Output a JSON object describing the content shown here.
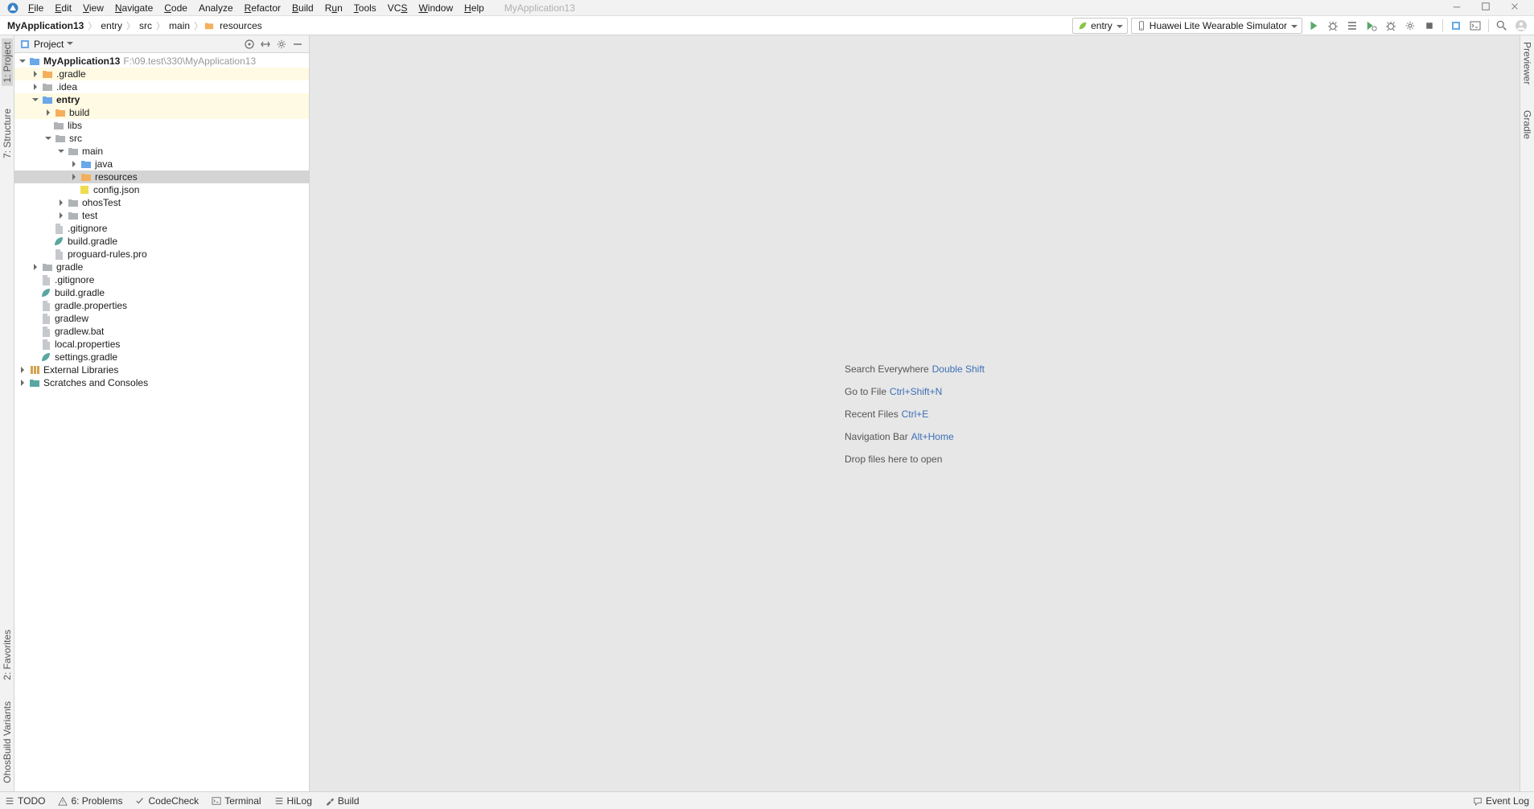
{
  "title": "MyApplication13",
  "menu": {
    "file": "File",
    "edit": "Edit",
    "view": "View",
    "navigate": "Navigate",
    "code": "Code",
    "analyze": "Analyze",
    "refactor": "Refactor",
    "build": "Build",
    "run": "Run",
    "tools": "Tools",
    "vcs": "VCS",
    "window": "Window",
    "help": "Help"
  },
  "breadcrumb": {
    "c0": "MyApplication13",
    "c1": "entry",
    "c2": "src",
    "c3": "main",
    "c4": "resources"
  },
  "run_config": "entry",
  "device": "Huawei Lite Wearable Simulator",
  "sidebar": {
    "title": "Project",
    "root": {
      "name": "MyApplication13",
      "path": "F:\\09.test\\330\\MyApplication13"
    },
    "gradle_dir": ".gradle",
    "idea_dir": ".idea",
    "entry": "entry",
    "build": "build",
    "libs": "libs",
    "src": "src",
    "main": "main",
    "java": "java",
    "resources": "resources",
    "config": "config.json",
    "ohosTest": "ohosTest",
    "test": "test",
    "gitignore": ".gitignore",
    "build_gradle": "build.gradle",
    "proguard": "proguard-rules.pro",
    "gradle_folder": "gradle",
    "root_gitignore": ".gitignore",
    "root_build_gradle": "build.gradle",
    "gradle_props": "gradle.properties",
    "gradlew": "gradlew",
    "gradlew_bat": "gradlew.bat",
    "local_props": "local.properties",
    "settings_gradle": "settings.gradle",
    "ext_libs": "External Libraries",
    "scratches": "Scratches and Consoles"
  },
  "hints": {
    "r1_text": "Search Everywhere",
    "r1_key": "Double Shift",
    "r2_text": "Go to File",
    "r2_key": "Ctrl+Shift+N",
    "r3_text": "Recent Files",
    "r3_key": "Ctrl+E",
    "r4_text": "Navigation Bar",
    "r4_key": "Alt+Home",
    "r5_text": "Drop files here to open"
  },
  "status": {
    "todo": "TODO",
    "problems": "6: Problems",
    "codecheck": "CodeCheck",
    "terminal": "Terminal",
    "hilog": "HiLog",
    "build": "Build",
    "eventlog": "Event Log"
  },
  "left_gutter": {
    "project": "1: Project",
    "structure": "7: Structure",
    "favorites": "2: Favorites",
    "ohos": "OhosBuild Variants"
  },
  "right_gutter": {
    "previewer": "Previewer",
    "gradle": "Gradle"
  }
}
